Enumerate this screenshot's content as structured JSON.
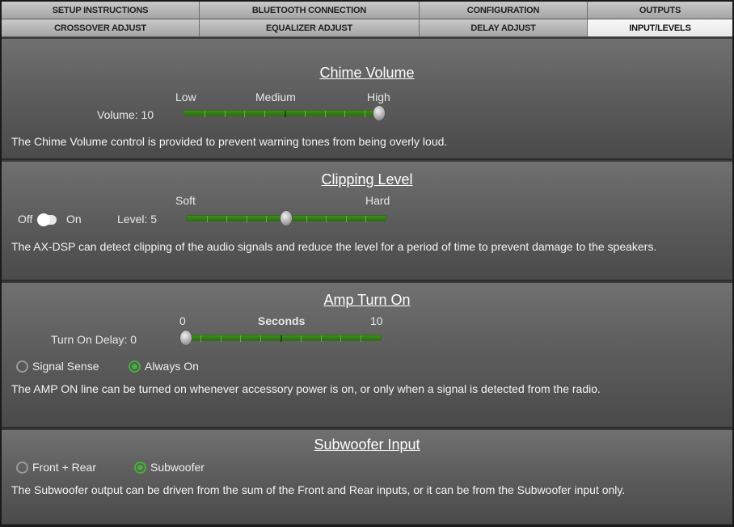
{
  "tabs": {
    "row1": [
      "SETUP INSTRUCTIONS",
      "BLUETOOTH CONNECTION",
      "CONFIGURATION",
      "OUTPUTS"
    ],
    "row2": [
      "CROSSOVER ADJUST",
      "EQUALIZER ADJUST",
      "DELAY ADJUST",
      "INPUT/LEVELS"
    ],
    "active": "INPUT/LEVELS"
  },
  "chime": {
    "title": "Chime Volume",
    "low": "Low",
    "medium": "Medium",
    "high": "High",
    "volume_label": "Volume: 10",
    "value": 10,
    "min": 0,
    "max": 10,
    "description": "The Chime Volume control is provided to prevent warning tones from being overly loud."
  },
  "clipping": {
    "title": "Clipping Level",
    "soft": "Soft",
    "hard": "Hard",
    "off": "Off",
    "on": "On",
    "level_label": "Level: 5",
    "value": 5,
    "min": 0,
    "max": 10,
    "toggle_state": "off",
    "description": "The AX-DSP can detect clipping of the audio signals and reduce the level for a period of time to prevent damage to the speakers."
  },
  "amp": {
    "title": "Amp Turn On",
    "min_label": "0",
    "units": "Seconds",
    "max_label": "10",
    "delay_label": "Turn On Delay: 0",
    "value": 0,
    "min": 0,
    "max": 10,
    "options": [
      "Signal Sense",
      "Always On"
    ],
    "selected": "Always On",
    "description": "The AMP ON line can be turned on whenever accessory power is on, or only when a signal is detected from the radio."
  },
  "subwoofer": {
    "title": "Subwoofer Input",
    "options": [
      "Front + Rear",
      "Subwoofer"
    ],
    "selected": "Subwoofer",
    "description": "The Subwoofer output can be driven from the sum of the Front and Rear inputs, or it can be from the Subwoofer input only."
  },
  "colors": {
    "accent": "#45b03a",
    "track": "#2f7d18"
  }
}
